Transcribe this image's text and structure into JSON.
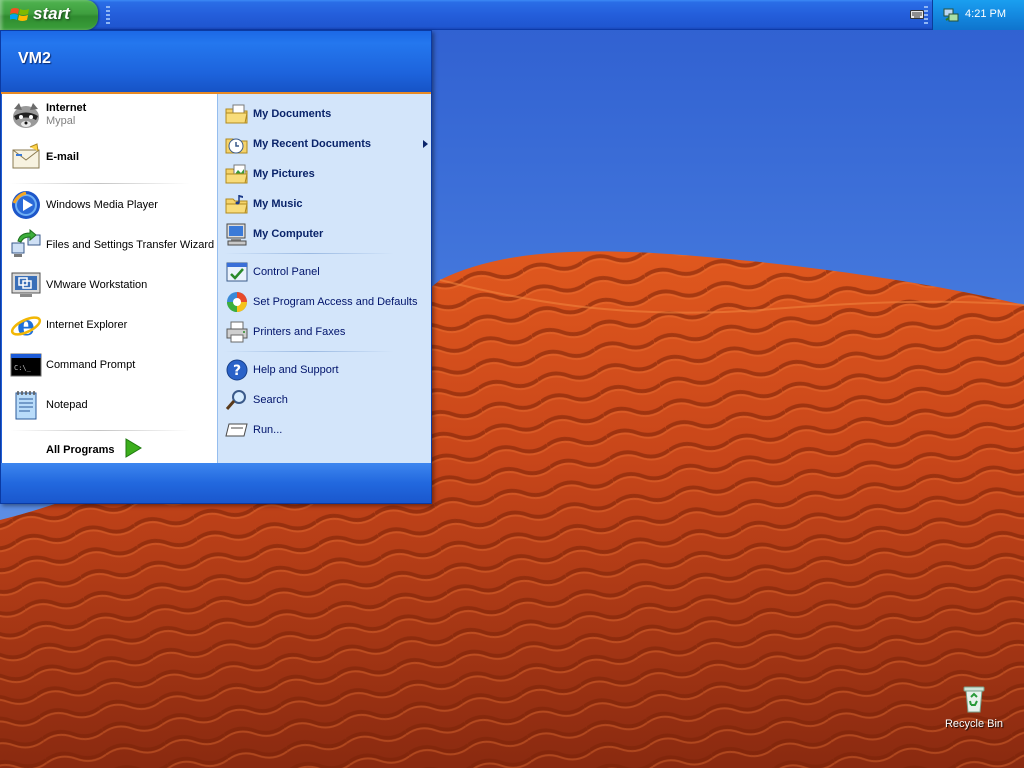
{
  "taskbar": {
    "start_label": "start",
    "clock": "4:21 PM"
  },
  "start_menu": {
    "user_name": "VM2",
    "pinned": [
      {
        "label": "Internet",
        "sublabel": "Mypal",
        "icon": "raccoon-browser-icon"
      },
      {
        "label": "E-mail",
        "icon": "mail-icon"
      }
    ],
    "recent": [
      {
        "label": "Windows Media Player",
        "icon": "media-player-icon"
      },
      {
        "label": "Files and Settings Transfer Wizard",
        "icon": "transfer-wizard-icon"
      },
      {
        "label": "VMware Workstation",
        "icon": "vmware-icon"
      },
      {
        "label": "Internet Explorer",
        "icon": "internet-explorer-icon"
      },
      {
        "label": "Command Prompt",
        "icon": "command-prompt-icon"
      },
      {
        "label": "Notepad",
        "icon": "notepad-icon"
      }
    ],
    "all_programs": "All Programs",
    "places": [
      {
        "label": "My Documents",
        "icon": "folder-documents-icon"
      },
      {
        "label": "My Recent Documents",
        "icon": "recent-documents-icon"
      },
      {
        "label": "My Pictures",
        "icon": "folder-pictures-icon"
      },
      {
        "label": "My Music",
        "icon": "folder-music-icon"
      },
      {
        "label": "My Computer",
        "icon": "computer-icon"
      }
    ],
    "settings": [
      {
        "label": "Control Panel",
        "icon": "control-panel-icon"
      },
      {
        "label": "Set Program Access and Defaults",
        "icon": "program-defaults-icon"
      },
      {
        "label": "Printers and Faxes",
        "icon": "printer-icon"
      }
    ],
    "tools": [
      {
        "label": "Help and Support",
        "icon": "help-icon"
      },
      {
        "label": "Search",
        "icon": "search-icon"
      },
      {
        "label": "Run...",
        "icon": "run-icon"
      }
    ]
  },
  "desktop": {
    "icons": [
      {
        "label": "Recycle Bin",
        "icon": "recycle-bin-icon"
      }
    ]
  }
}
